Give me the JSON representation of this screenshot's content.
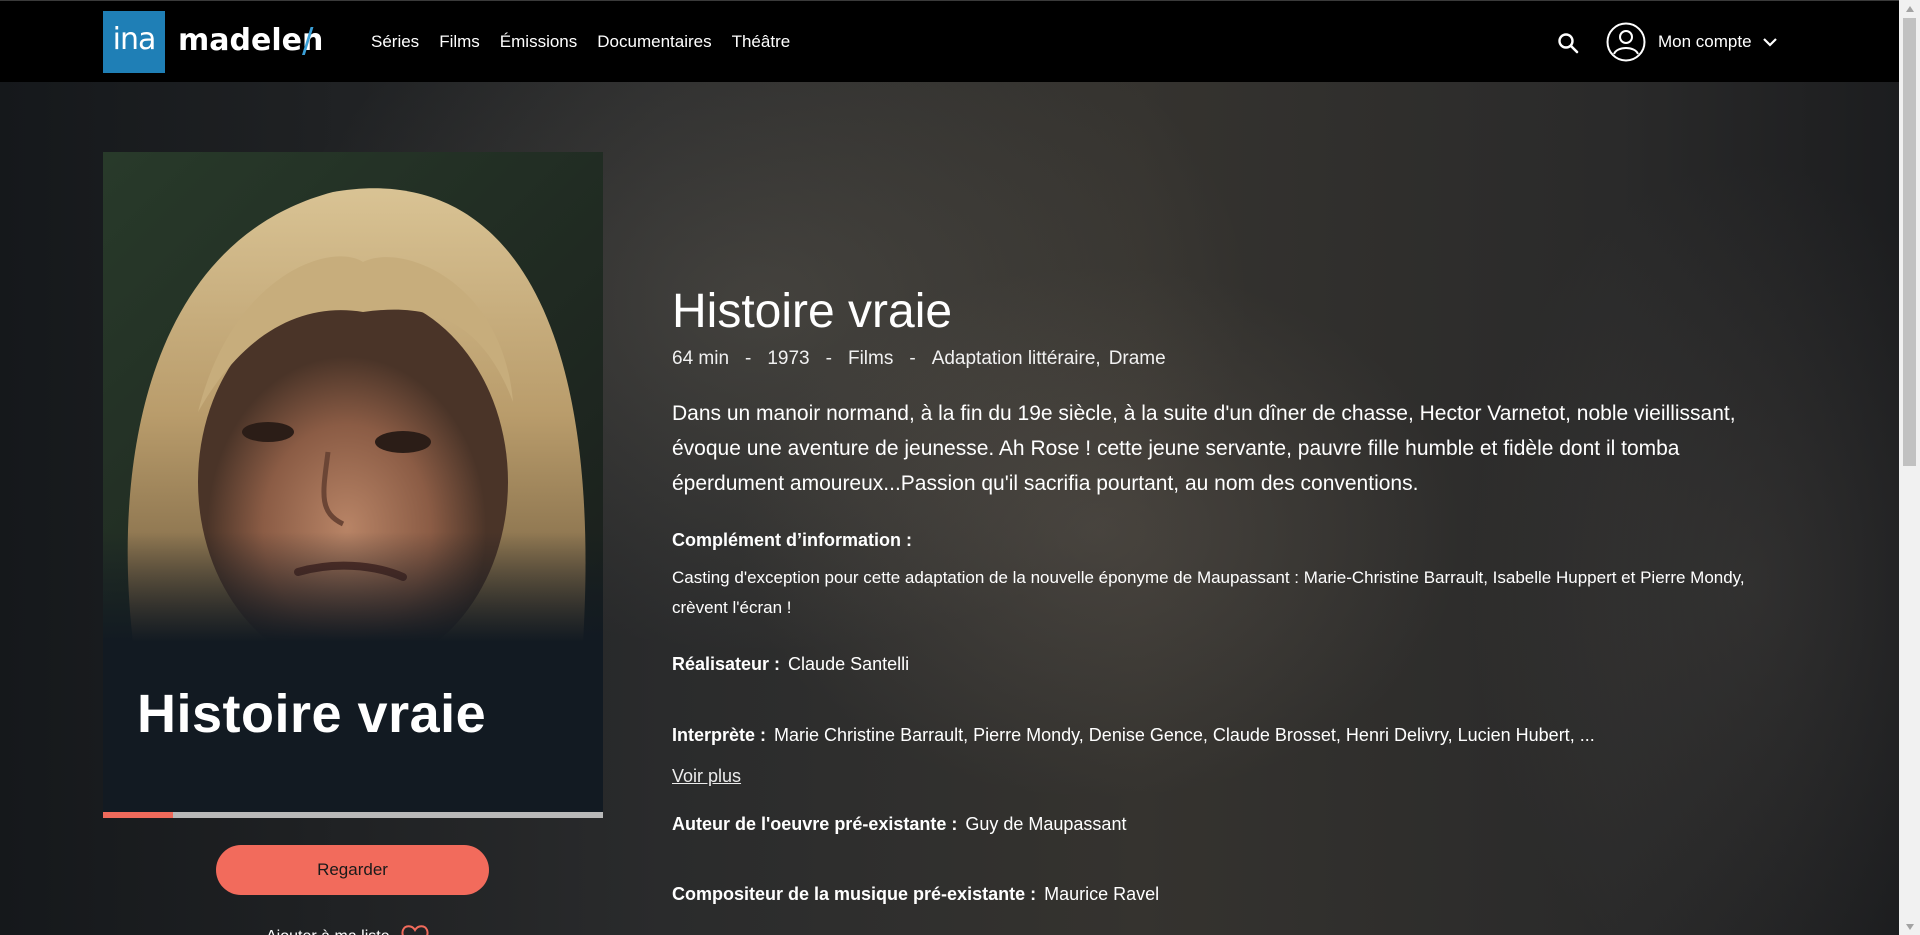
{
  "header": {
    "logo_text": "ina",
    "brand": "madelen",
    "brand_slash": "/",
    "nav": [
      "Séries",
      "Films",
      "Émissions",
      "Documentaires",
      "Théâtre"
    ],
    "account_label": "Mon compte"
  },
  "poster": {
    "title": "Histoire vraie",
    "progress_fraction": 0.14
  },
  "actions": {
    "watch_label": "Regarder",
    "favorite_label": "Ajouter à ma liste"
  },
  "program": {
    "title": "Histoire vraie",
    "duration": "64 min",
    "year": "1973",
    "category": "Films",
    "genres": [
      "Adaptation littéraire,",
      "Drame"
    ],
    "separator": "-",
    "synopsis": "Dans un manoir normand, à la fin du 19e siècle, à la suite d'un dîner de chasse, Hector Varnetot, noble vieillissant, évoque une aventure de jeunesse. Ah Rose ! cette jeune servante, pauvre fille humble et fidèle dont il tomba éperdument amoureux...Passion qu'il sacrifia pourtant, au nom des conventions.",
    "complement_label": "Complément d’information :",
    "complement_text": "Casting d'exception pour cette adaptation de la nouvelle éponyme de Maupassant : Marie-Christine Barrault, Isabelle Huppert et Pierre Mondy, crèvent l'écran !",
    "director_label": "Réalisateur :",
    "director": "Claude Santelli",
    "cast_label": "Interprète :",
    "cast": "Marie Christine Barrault, Pierre Mondy, Denise Gence, Claude Brosset, Henri Delivry, Lucien Hubert,  ...",
    "voir_plus": "Voir plus",
    "author_label": "Auteur de l'oeuvre pré-existante :",
    "author": "Guy de Maupassant",
    "composer_label": "Compositeur de la musique pré-existante :",
    "composer": "Maurice Ravel"
  },
  "colors": {
    "accent": "#f26b5c",
    "logo_blue": "#1f7fb6",
    "header_bg": "#000000"
  }
}
